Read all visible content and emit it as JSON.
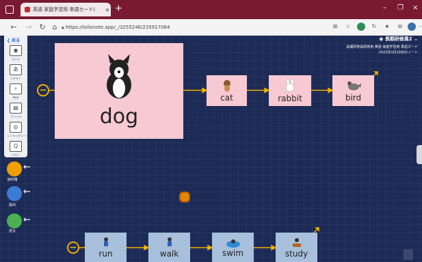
{
  "browser": {
    "tab_title": "英語 家庭学習用 単語カード(",
    "tab_close": "×",
    "new_tab": "+",
    "window_controls": [
      "–",
      "❐",
      "×"
    ],
    "address": "https://loilonote.app/_/3255246/235917084"
  },
  "app": {
    "back_label": "戻る",
    "tools": [
      {
        "label": "カメラ",
        "icon": "camera-icon"
      },
      {
        "label": "テキスト",
        "icon": "text-icon"
      },
      {
        "label": "Web",
        "icon": "web-icon"
      },
      {
        "label": "ファイル",
        "icon": "file-icon"
      },
      {
        "label": "シンキングツール",
        "icon": "thinking-tool-icon"
      },
      {
        "label": "テスト",
        "icon": "test-icon"
      }
    ],
    "side_actions": [
      {
        "label": "資料箱"
      },
      {
        "label": "提出"
      },
      {
        "label": "送る"
      }
    ],
    "user": {
      "name": "長期研修員2",
      "class": "長期研修員研修用 英語 家庭学習用 単語カード",
      "date": "2022年1月19日のノート"
    },
    "cards_top": {
      "main": "dog",
      "items": [
        "cat",
        "rabbit",
        "bird"
      ]
    },
    "cards_bottom": {
      "items": [
        "run",
        "walk",
        "swim",
        "study"
      ]
    },
    "colors": {
      "accent": "#f0b000",
      "card_pink": "#f7c9d2",
      "card_blue": "#a8c0dc",
      "tabbar": "#7a1a30"
    }
  }
}
